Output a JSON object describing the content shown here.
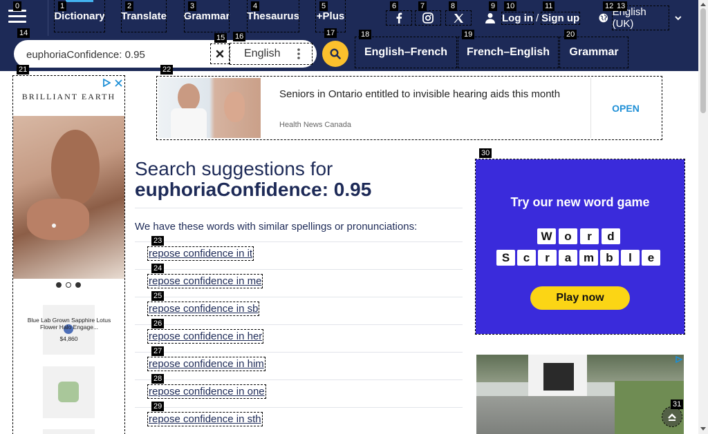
{
  "nav": {
    "items": [
      {
        "label": "Dictionary",
        "badge": "1"
      },
      {
        "label": "Translate",
        "badge": "2"
      },
      {
        "label": "Grammar",
        "badge": "3"
      },
      {
        "label": "Thesaurus",
        "badge": "4"
      },
      {
        "label": "+Plus",
        "badge": "5"
      }
    ],
    "menu_badge": "0",
    "social_badges": [
      "6",
      "7",
      "8"
    ],
    "login": "Log in",
    "slash": "/",
    "signup": "Sign up",
    "login_badge": "9",
    "login_badge2": "10",
    "signup_badge": "11",
    "lang_label": "English (UK)",
    "lang_badges": [
      "12",
      "13"
    ]
  },
  "search": {
    "value": "euphoriaConfidence: 0.95",
    "badge": "14",
    "clear_badge": "15",
    "lang_badge": "16",
    "language": "English",
    "submit_badge": "17"
  },
  "dict_links": [
    {
      "label": "English–French",
      "badge": "18"
    },
    {
      "label": "French–English",
      "badge": "19"
    },
    {
      "label": "Grammar",
      "badge": "20"
    }
  ],
  "left_ad": {
    "badge": "21",
    "brand": "BRILLIANT EARTH",
    "product_name": "Blue Lab Grown Sapphire Lotus Flower Halo Engage...",
    "price": "$4,860"
  },
  "top_ad": {
    "badge": "22",
    "headline": "Seniors in Ontario entitled to invisible hearing aids this month",
    "source": "Health News Canada",
    "cta": "OPEN"
  },
  "main": {
    "heading_line1": "Search suggestions for",
    "heading_line2": "euphoriaConfidence: 0.95",
    "intro": "We have these words with similar spellings or pronunciations:",
    "suggestions": [
      {
        "text": "repose confidence in it",
        "badge": "23"
      },
      {
        "text": "repose confidence in me",
        "badge": "24"
      },
      {
        "text": "repose confidence in sb",
        "badge": "25"
      },
      {
        "text": "repose confidence in her",
        "badge": "26"
      },
      {
        "text": "repose confidence in him",
        "badge": "27"
      },
      {
        "text": "repose confidence in one",
        "badge": "28"
      },
      {
        "text": "repose confidence in sth",
        "badge": "29"
      }
    ]
  },
  "game_ad": {
    "badge": "30",
    "title": "Try our new word game",
    "row1": [
      "W",
      "o",
      "r",
      "d"
    ],
    "row2": [
      "S",
      "c",
      "r",
      "a",
      "m",
      "b",
      "l",
      "e"
    ],
    "cta": "Play now"
  },
  "scroll_top_badge": "31",
  "colors": {
    "navy": "#1d2a57",
    "accent_yellow": "#fbc02d",
    "game_blue": "#3a2bdb",
    "active_tab": "#43b3f0"
  }
}
